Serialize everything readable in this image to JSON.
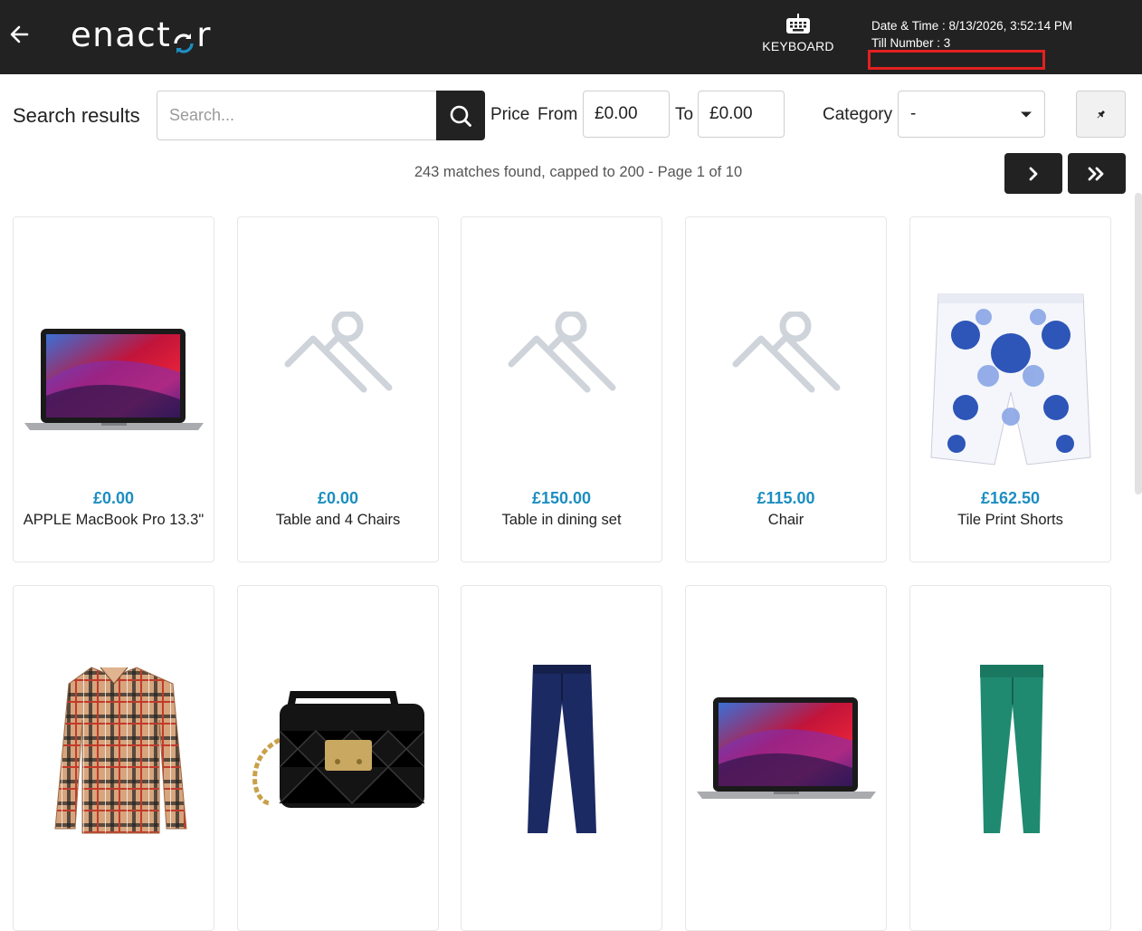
{
  "header": {
    "logo_text": "enactor",
    "keyboard_label": "KEYBOARD",
    "datetime_text": "Date & Time : 8/13/2026, 3:52:14 PM",
    "till_text": "Till Number : 3"
  },
  "search": {
    "label": "Search results",
    "placeholder": "Search...",
    "price_label": "Price",
    "from_label": "From",
    "from_value": "£0.00",
    "to_label": "To",
    "to_value": "£0.00",
    "category_label": "Category",
    "category_value": "-"
  },
  "results": {
    "summary": "243 matches found, capped to 200 - Page 1 of 10"
  },
  "products": [
    {
      "price": "£0.00",
      "name": "APPLE MacBook Pro 13.3\"",
      "image": "laptop"
    },
    {
      "price": "£0.00",
      "name": "Table and 4 Chairs",
      "image": "placeholder"
    },
    {
      "price": "£150.00",
      "name": "Table in dining set",
      "image": "placeholder"
    },
    {
      "price": "£115.00",
      "name": "Chair",
      "image": "placeholder"
    },
    {
      "price": "£162.50",
      "name": "Tile Print Shorts",
      "image": "shorts"
    },
    {
      "price": "",
      "name": "",
      "image": "shirt"
    },
    {
      "price": "",
      "name": "",
      "image": "handbag"
    },
    {
      "price": "",
      "name": "",
      "image": "navy-trousers"
    },
    {
      "price": "",
      "name": "",
      "image": "laptop"
    },
    {
      "price": "",
      "name": "",
      "image": "green-trousers"
    }
  ],
  "colors": {
    "header_bg": "#222222",
    "price": "#1c8ec0",
    "logo_accent": "#1c8ec0",
    "highlight_box": "#e32020"
  }
}
